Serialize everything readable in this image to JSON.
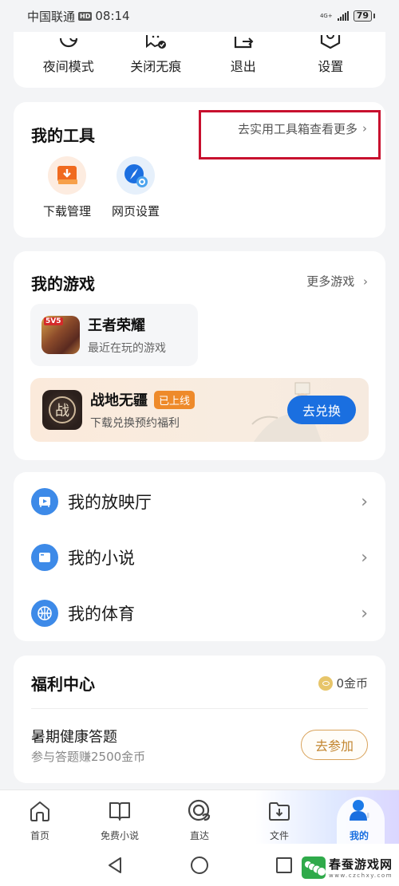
{
  "status_bar": {
    "carrier": "中国联通",
    "hd": "HD",
    "time": "08:14",
    "network": "4G+",
    "battery": "79"
  },
  "quick_actions": [
    {
      "label": "夜间模式",
      "icon": "moon-icon"
    },
    {
      "label": "关闭无痕",
      "icon": "incognito-icon"
    },
    {
      "label": "退出",
      "icon": "exit-icon"
    },
    {
      "label": "设置",
      "icon": "settings-icon"
    }
  ],
  "tools": {
    "title": "我的工具",
    "more_label": "去实用工具箱查看更多",
    "items": [
      {
        "label": "下载管理",
        "icon": "download-icon"
      },
      {
        "label": "网页设置",
        "icon": "compass-settings-icon"
      }
    ]
  },
  "games": {
    "title": "我的游戏",
    "more_label": "更多游戏",
    "recent": {
      "name": "王者荣耀",
      "subtitle": "最近在玩的游戏"
    },
    "promo": {
      "name": "战地无疆",
      "badge": "已上线",
      "subtitle": "下载兑换预约福利",
      "icon_char": "战",
      "button": "去兑换"
    }
  },
  "links": [
    {
      "label": "我的放映厅",
      "icon": "video-icon"
    },
    {
      "label": "我的小说",
      "icon": "book-icon"
    },
    {
      "label": "我的体育",
      "icon": "basketball-icon"
    }
  ],
  "welfare": {
    "title": "福利中心",
    "coins": "0金币",
    "task_title": "暑期健康答题",
    "task_subtitle": "参与答题赚2500金币",
    "button": "去参加"
  },
  "bottom_nav": [
    {
      "label": "首页",
      "icon": "home-icon",
      "active": false
    },
    {
      "label": "免费小说",
      "icon": "book-open-icon",
      "active": false
    },
    {
      "label": "直达",
      "icon": "direct-icon",
      "active": false
    },
    {
      "label": "文件",
      "icon": "folder-download-icon",
      "active": false
    },
    {
      "label": "我的",
      "icon": "user-icon",
      "active": true
    }
  ],
  "watermark": {
    "title": "春蚕游戏网",
    "url": "www.czchxy.com"
  },
  "colors": {
    "accent_blue": "#1a6fe0",
    "highlight_red": "#c8102e",
    "badge_orange": "#ee8a2a",
    "gold": "#d9a25a"
  }
}
